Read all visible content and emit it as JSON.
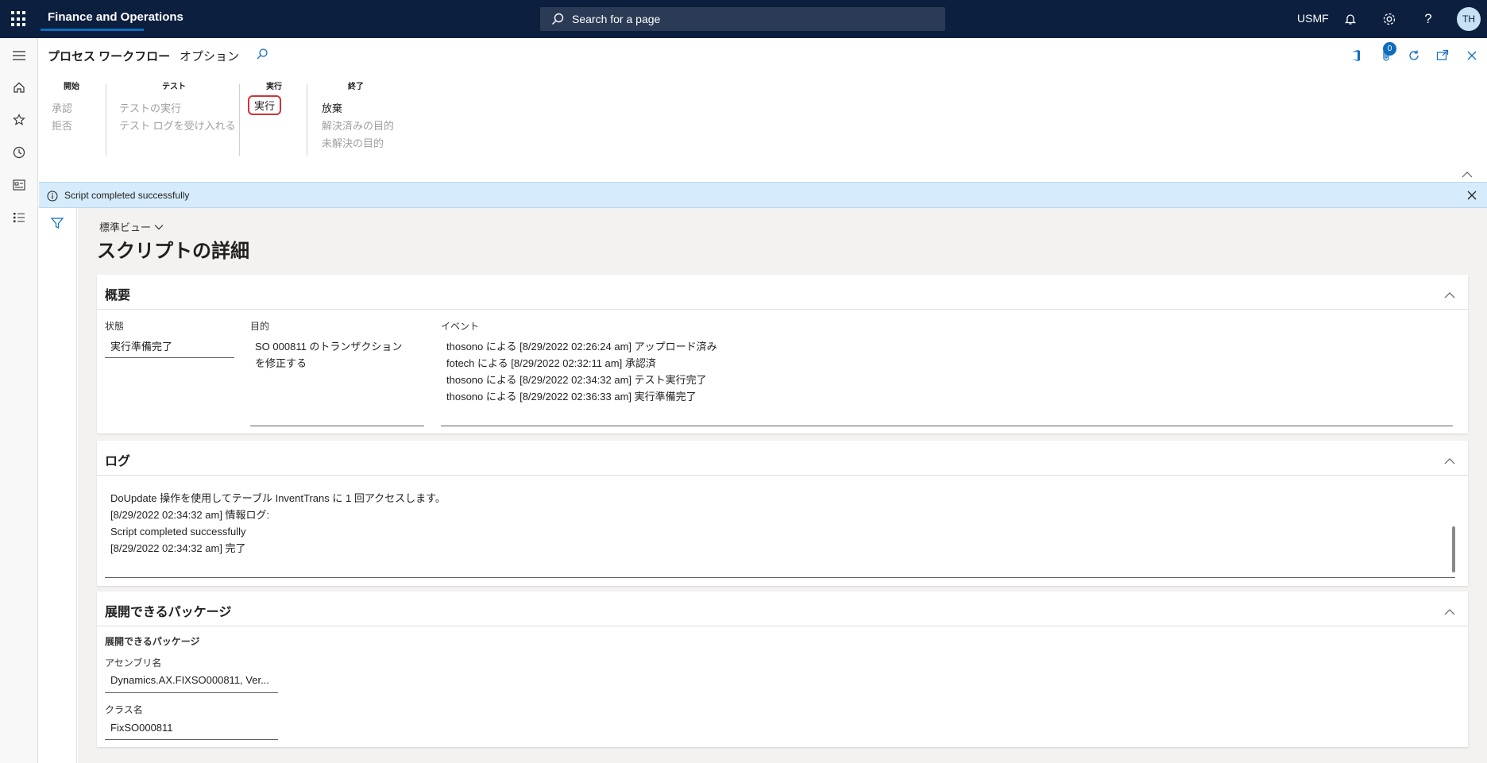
{
  "topbar": {
    "app_title": "Finance and Operations",
    "search_placeholder": "Search for a page",
    "company": "USMF",
    "avatar_initials": "TH"
  },
  "actionpane": {
    "tabs": [
      {
        "label": "プロセス ワークフロー",
        "active": true
      },
      {
        "label": "オプション",
        "active": false
      }
    ],
    "groups": {
      "start": {
        "title": "開始",
        "commands": [
          "承認",
          "拒否"
        ]
      },
      "test": {
        "title": "テスト",
        "commands": [
          "テストの実行",
          "テスト ログを受け入れる"
        ]
      },
      "run": {
        "title": "実行",
        "commands": [
          "実行"
        ]
      },
      "end": {
        "title": "終了",
        "commands": [
          "放棄",
          "解決済みの目的",
          "未解決の目的"
        ]
      }
    },
    "attachments_count": "0"
  },
  "message": {
    "text": "Script completed successfully"
  },
  "page": {
    "view_selector": "標準ビュー",
    "title": "スクリプトの詳細"
  },
  "overview": {
    "title": "概要",
    "status_label": "状態",
    "status_value": "実行準備完了",
    "purpose_label": "目的",
    "purpose_value_line1": "SO 000811 のトランザクション",
    "purpose_value_line2": "を修正する",
    "events_label": "イベント",
    "events": [
      "thosono による [8/29/2022 02:26:24 am] アップロード済み",
      "fotech による [8/29/2022 02:32:11 am] 承認済",
      "thosono による [8/29/2022 02:34:32 am] テスト実行完了",
      "thosono による [8/29/2022 02:36:33 am] 実行準備完了"
    ]
  },
  "log": {
    "title": "ログ",
    "lines": [
      "DoUpdate 操作を使用してテーブル InventTrans に 1 回アクセスします。",
      "[8/29/2022 02:34:32 am] 情報ログ:",
      "Script completed successfully",
      "[8/29/2022 02:34:32 am] 完了"
    ]
  },
  "packages": {
    "title": "展開できるパッケージ",
    "subheading": "展開できるパッケージ",
    "assembly_label": "アセンブリ名",
    "assembly_value": "Dynamics.AX.FIXSO000811, Ver...",
    "class_label": "クラス名",
    "class_value": "FixSO000811"
  },
  "colors": {
    "topbar": "#0c1f3f",
    "accent": "#0f6cbd",
    "highlight": "#d13438",
    "infobar": "#d6ebfb"
  }
}
